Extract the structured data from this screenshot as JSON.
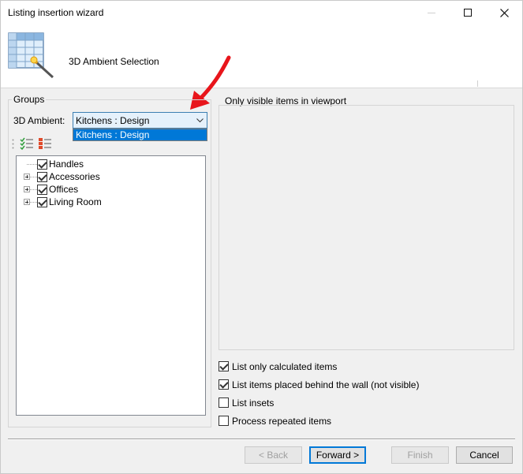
{
  "window": {
    "title": "Listing insertion wizard"
  },
  "header": {
    "title": "3D Ambient Selection"
  },
  "groups": {
    "label": "Groups",
    "ambient_label": "3D Ambient:",
    "ambient_value": "Kitchens : Design",
    "dropdown_options": [
      "Kitchens : Design"
    ],
    "tree": [
      {
        "label": "Handles",
        "checked": true,
        "expandable": false
      },
      {
        "label": "Accessories",
        "checked": true,
        "expandable": true
      },
      {
        "label": "Offices",
        "checked": true,
        "expandable": true
      },
      {
        "label": "Living Room",
        "checked": true,
        "expandable": true
      }
    ]
  },
  "viewport": {
    "label": "Only visible items in viewport"
  },
  "options": [
    {
      "label": "List only calculated items",
      "checked": true
    },
    {
      "label": "List items placed behind the wall (not visible)",
      "checked": true
    },
    {
      "label": "List insets",
      "checked": false
    },
    {
      "label": "Process repeated items",
      "checked": false
    }
  ],
  "buttons": {
    "back": "< Back",
    "forward": "Forward >",
    "finish": "Finish",
    "cancel": "Cancel"
  },
  "colors": {
    "accent": "#0078d7",
    "annotation_arrow": "#e8151b"
  }
}
